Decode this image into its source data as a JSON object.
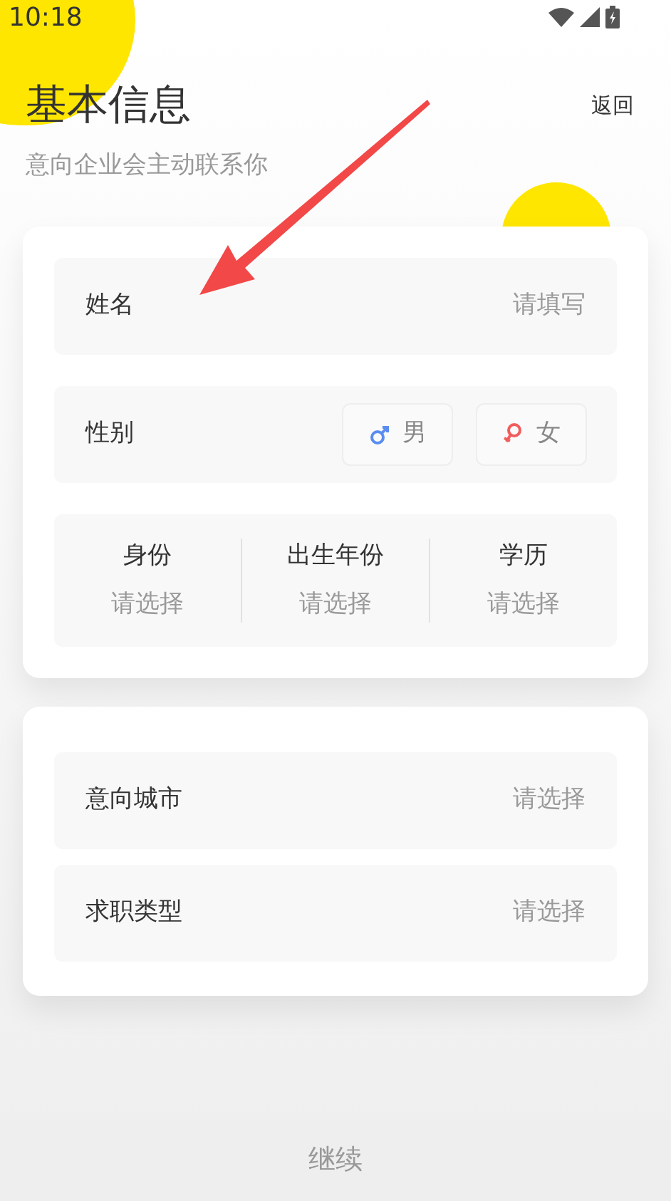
{
  "status_bar": {
    "time": "10:18"
  },
  "header": {
    "title": "基本信息",
    "back": "返回",
    "subtitle": "意向企业会主动联系你"
  },
  "basic_card": {
    "name_field": {
      "label": "姓名",
      "placeholder": "请填写"
    },
    "gender": {
      "label": "性别",
      "options": [
        {
          "kind": "male",
          "label": "男",
          "selected": false
        },
        {
          "kind": "female",
          "label": "女",
          "selected": false
        }
      ]
    },
    "pickers": [
      {
        "label": "身份",
        "value": "请选择"
      },
      {
        "label": "出生年份",
        "value": "请选择"
      },
      {
        "label": "学历",
        "value": "请选择"
      }
    ]
  },
  "intent_card": {
    "rows": [
      {
        "label": "意向城市",
        "value": "请选择"
      },
      {
        "label": "求职类型",
        "value": "请选择"
      }
    ]
  },
  "continue_button": "继续"
}
